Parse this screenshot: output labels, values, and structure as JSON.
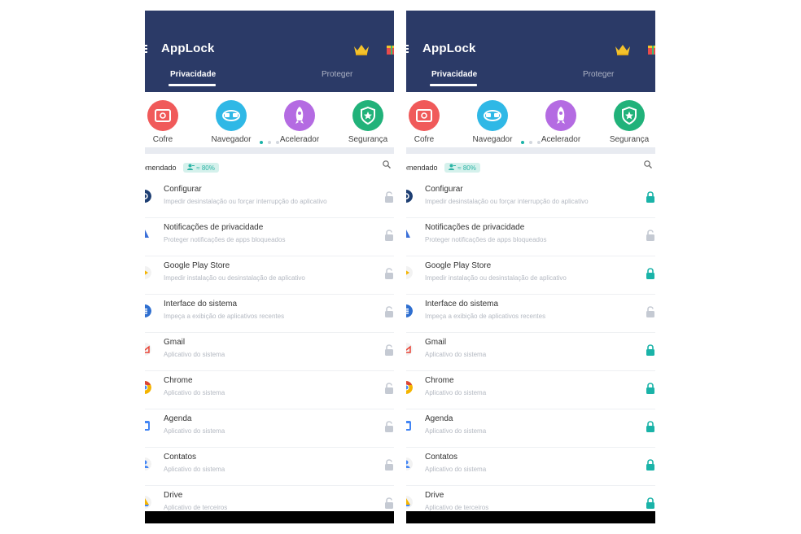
{
  "colors": {
    "header": "#2b3a67",
    "accent": "#1ab3a8",
    "lock_locked": "#1ab3a8",
    "lock_unlocked": "#c5cad3",
    "separator": "#e8ebf1"
  },
  "screens": [
    {
      "app_title": "AppLock",
      "tabs": [
        {
          "label": "Privacidade",
          "active": true
        },
        {
          "label": "Proteger",
          "active": false
        }
      ],
      "features": [
        {
          "label": "Cofre",
          "icon": "safe-icon",
          "color": "#f05a5a"
        },
        {
          "label": "Navegador",
          "icon": "browser-icon",
          "color": "#2fb8e6"
        },
        {
          "label": "Acelerador",
          "icon": "rocket-icon",
          "color": "#b46be2"
        },
        {
          "label": "Segurança",
          "icon": "shield-icon",
          "color": "#21b27a"
        }
      ],
      "recommended": {
        "label": "omendado",
        "badge": "≈ 80%"
      },
      "apps": [
        {
          "title": "Configurar",
          "subtitle": "Impedir desinstalação ou forçar interrupção do aplicativo",
          "icon": "settings-icon",
          "locked": false
        },
        {
          "title": "Notificações de privacidade",
          "subtitle": "Proteger notificações de apps bloqueados",
          "icon": "notification-icon",
          "locked": false
        },
        {
          "title": "Google Play Store",
          "subtitle": "Impedir instalação ou desinstalação de aplicativo",
          "icon": "play-store-icon",
          "locked": false
        },
        {
          "title": "Interface do sistema",
          "subtitle": "Impeça a exibição de aplicativos recentes",
          "icon": "system-ui-icon",
          "locked": false
        },
        {
          "title": "Gmail",
          "subtitle": "Aplicativo do sistema",
          "icon": "gmail-icon",
          "locked": false
        },
        {
          "title": "Chrome",
          "subtitle": "Aplicativo do sistema",
          "icon": "chrome-icon",
          "locked": false
        },
        {
          "title": "Agenda",
          "subtitle": "Aplicativo do sistema",
          "icon": "calendar-icon",
          "locked": false
        },
        {
          "title": "Contatos",
          "subtitle": "Aplicativo do sistema",
          "icon": "contacts-icon",
          "locked": false
        },
        {
          "title": "Drive",
          "subtitle": "Aplicativo de terceiros",
          "icon": "drive-icon",
          "locked": false
        }
      ]
    },
    {
      "app_title": "AppLock",
      "tabs": [
        {
          "label": "Privacidade",
          "active": true
        },
        {
          "label": "Proteger",
          "active": false
        }
      ],
      "features": [
        {
          "label": "Cofre",
          "icon": "safe-icon",
          "color": "#f05a5a"
        },
        {
          "label": "Navegador",
          "icon": "browser-icon",
          "color": "#2fb8e6"
        },
        {
          "label": "Acelerador",
          "icon": "rocket-icon",
          "color": "#b46be2"
        },
        {
          "label": "Segurança",
          "icon": "shield-icon",
          "color": "#21b27a"
        }
      ],
      "recommended": {
        "label": "omendado",
        "badge": "≈ 80%"
      },
      "apps": [
        {
          "title": "Configurar",
          "subtitle": "Impedir desinstalação ou forçar interrupção do aplicativo",
          "icon": "settings-icon",
          "locked": true
        },
        {
          "title": "Notificações de privacidade",
          "subtitle": "Proteger notificações de apps bloqueados",
          "icon": "notification-icon",
          "locked": false
        },
        {
          "title": "Google Play Store",
          "subtitle": "Impedir instalação ou desinstalação de aplicativo",
          "icon": "play-store-icon",
          "locked": true
        },
        {
          "title": "Interface do sistema",
          "subtitle": "Impeça a exibição de aplicativos recentes",
          "icon": "system-ui-icon",
          "locked": false
        },
        {
          "title": "Gmail",
          "subtitle": "Aplicativo do sistema",
          "icon": "gmail-icon",
          "locked": true
        },
        {
          "title": "Chrome",
          "subtitle": "Aplicativo do sistema",
          "icon": "chrome-icon",
          "locked": true
        },
        {
          "title": "Agenda",
          "subtitle": "Aplicativo do sistema",
          "icon": "calendar-icon",
          "locked": true
        },
        {
          "title": "Contatos",
          "subtitle": "Aplicativo do sistema",
          "icon": "contacts-icon",
          "locked": true
        },
        {
          "title": "Drive",
          "subtitle": "Aplicativo de terceiros",
          "icon": "drive-icon",
          "locked": true
        }
      ]
    }
  ]
}
